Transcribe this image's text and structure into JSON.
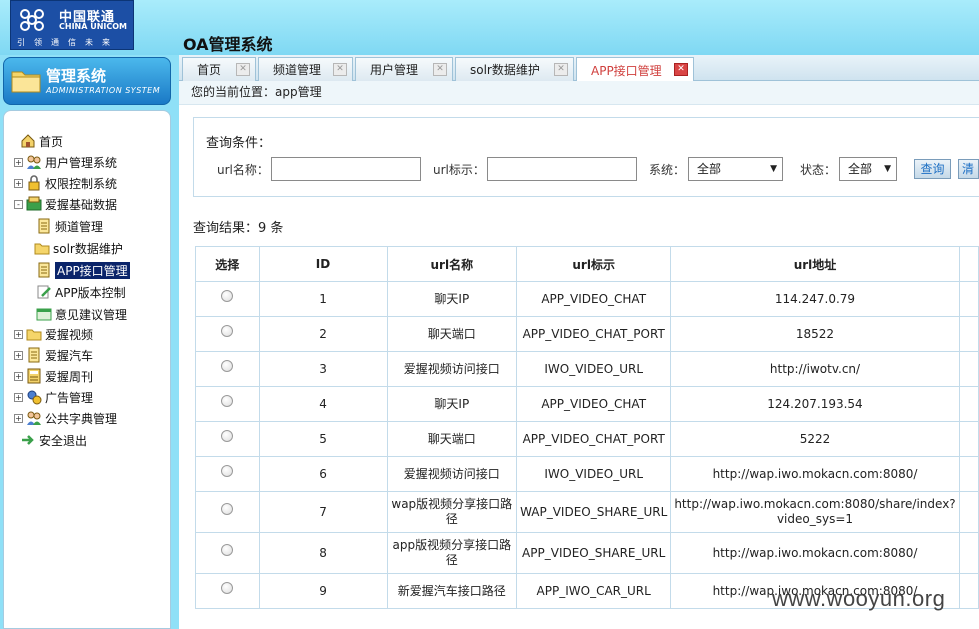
{
  "header": {
    "logo_cn": "中国联通",
    "logo_en": "CHINA UNICOM",
    "logo_slogan": "引领通信未来",
    "app_title": "OA管理系统"
  },
  "sidebar": {
    "head_title": "管理系统",
    "head_subtitle": "ADMINISTRATION SYSTEM",
    "items": [
      {
        "label": "首页",
        "icon": "home-icon",
        "toggle": ""
      },
      {
        "label": "用户管理系统",
        "icon": "users-icon",
        "toggle": "+"
      },
      {
        "label": "权限控制系统",
        "icon": "lock-icon",
        "toggle": "+"
      },
      {
        "label": "爱握基础数据",
        "icon": "database-icon",
        "toggle": "-"
      },
      {
        "label": "频道管理",
        "icon": "document-icon",
        "toggle": ""
      },
      {
        "label": "solr数据维护",
        "icon": "folder-icon",
        "toggle": ""
      },
      {
        "label": "APP接口管理",
        "icon": "document-icon",
        "toggle": ""
      },
      {
        "label": "APP版本控制",
        "icon": "edit-icon",
        "toggle": ""
      },
      {
        "label": "意见建议管理",
        "icon": "window-icon",
        "toggle": ""
      },
      {
        "label": "爱握视频",
        "icon": "folder-icon",
        "toggle": "+"
      },
      {
        "label": "爱握汽车",
        "icon": "document-icon",
        "toggle": "+"
      },
      {
        "label": "爱握周刊",
        "icon": "calculator-icon",
        "toggle": "+"
      },
      {
        "label": "广告管理",
        "icon": "settings-icon",
        "toggle": "+"
      },
      {
        "label": "公共字典管理",
        "icon": "users-icon",
        "toggle": "+"
      },
      {
        "label": "安全退出",
        "icon": "exit-icon",
        "toggle": ""
      }
    ]
  },
  "tabs": [
    {
      "label": "首页",
      "active": false
    },
    {
      "label": "频道管理",
      "active": false
    },
    {
      "label": "用户管理",
      "active": false
    },
    {
      "label": "solr数据维护",
      "active": false
    },
    {
      "label": "APP接口管理",
      "active": true
    }
  ],
  "breadcrumb": "您的当前位置：app管理",
  "query": {
    "title": "查询条件：",
    "url_name_label": "url名称：",
    "url_name_value": "",
    "url_tag_label": "url标示：",
    "url_tag_value": "",
    "system_label": "系统：",
    "system_value": "全部",
    "status_label": "状态：",
    "status_value": "全部",
    "search_button": "查询",
    "clear_button": "清空"
  },
  "result_count": "查询结果：9 条",
  "table": {
    "headers": [
      "选择",
      "ID",
      "url名称",
      "url标示",
      "url地址"
    ],
    "rows": [
      {
        "id": "1",
        "name": "聊天IP",
        "tag": "APP_VIDEO_CHAT",
        "url": "114.247.0.79"
      },
      {
        "id": "2",
        "name": "聊天端口",
        "tag": "APP_VIDEO_CHAT_PORT",
        "url": "18522"
      },
      {
        "id": "3",
        "name": "爱握视频访问接口",
        "tag": "IWO_VIDEO_URL",
        "url": "http://iwotv.cn/"
      },
      {
        "id": "4",
        "name": "聊天IP",
        "tag": "APP_VIDEO_CHAT",
        "url": "124.207.193.54"
      },
      {
        "id": "5",
        "name": "聊天端口",
        "tag": "APP_VIDEO_CHAT_PORT",
        "url": "5222"
      },
      {
        "id": "6",
        "name": "爱握视频访问接口",
        "tag": "IWO_VIDEO_URL",
        "url": "http://wap.iwo.mokacn.com:8080/"
      },
      {
        "id": "7",
        "name": "wap版视频分享接口路径",
        "tag": "WAP_VIDEO_SHARE_URL",
        "url": "http://wap.iwo.mokacn.com:8080/share/index?video_sys=1"
      },
      {
        "id": "8",
        "name": "app版视频分享接口路径",
        "tag": "APP_VIDEO_SHARE_URL",
        "url": "http://wap.iwo.mokacn.com:8080/"
      },
      {
        "id": "9",
        "name": "新爱握汽车接口路径",
        "tag": "APP_IWO_CAR_URL",
        "url": "http://wap.iwo.mokacn.com:8080/"
      }
    ]
  },
  "watermark": "www.wooyun.org",
  "colors": {
    "background": "#8fe0f7",
    "active_tab_text": "#d0403e",
    "selected_bg": "#0a246a",
    "brand_blue": "#1c4fa5"
  }
}
